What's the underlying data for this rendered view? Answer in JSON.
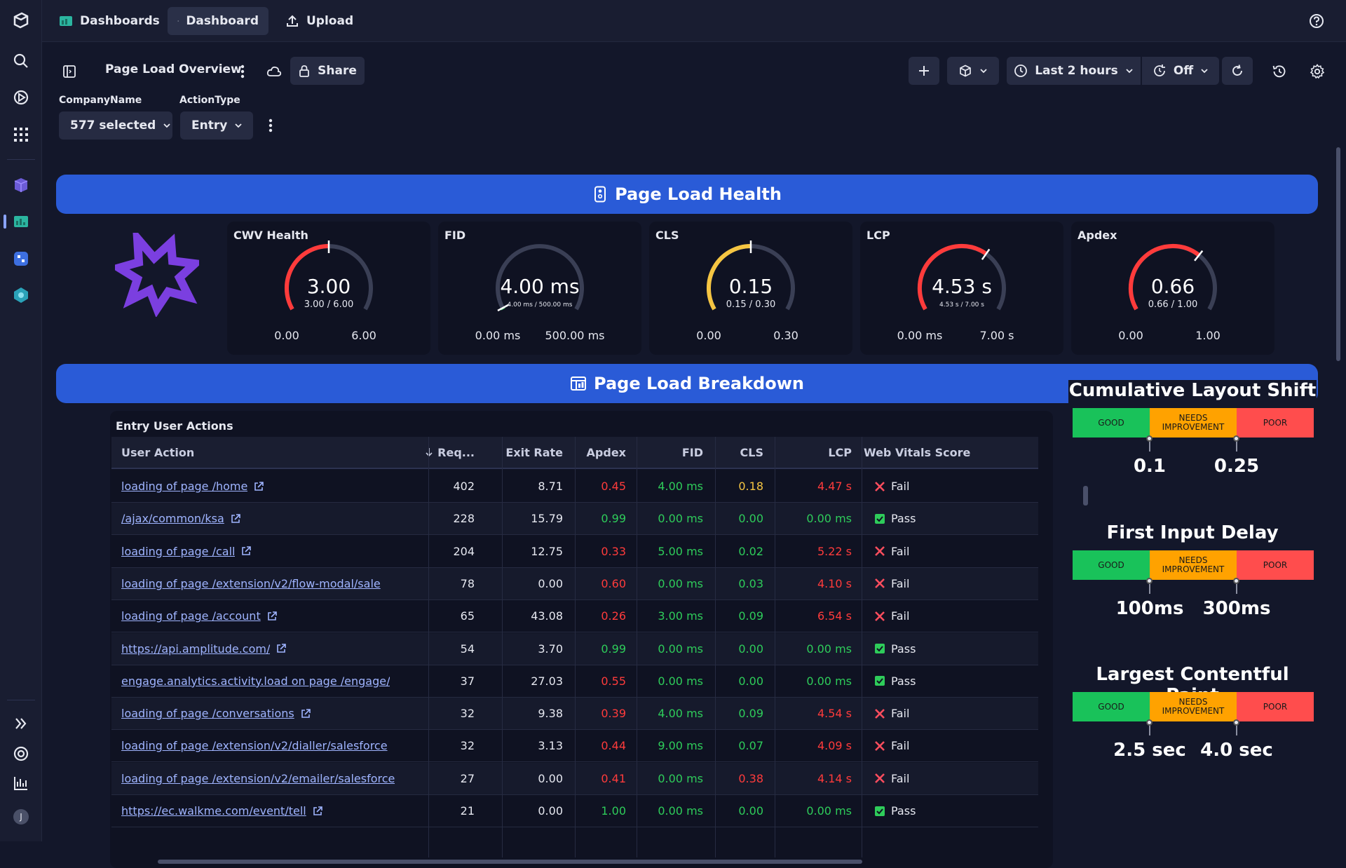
{
  "topbar": {
    "dashboards_label": "Dashboards",
    "new_dashboard_label": "Dashboard",
    "upload_label": "Upload"
  },
  "toolbar": {
    "dashboard_title": "Page Load Overview",
    "share_label": "Share",
    "timeframe_label": "Last 2 hours",
    "refresh_label": "Off"
  },
  "filters": {
    "company": {
      "label": "CompanyName",
      "value": "577 selected"
    },
    "action_type": {
      "label": "ActionType",
      "value": "Entry"
    }
  },
  "sections": {
    "health": "Page Load Health",
    "breakdown": "Page Load Breakdown"
  },
  "gauges": [
    {
      "title": "CWV Health",
      "value": "3.00",
      "sub": "3.00 / 6.00",
      "min": "0.00",
      "max": "6.00",
      "fraction": 0.5,
      "color": "#ff3b3b"
    },
    {
      "title": "FID",
      "value": "4.00 ms",
      "sub": "4.00 ms / 500.00 ms",
      "min": "0.00 ms",
      "max": "500.00 ms",
      "fraction": 0.008,
      "color": "#2ecc5a"
    },
    {
      "title": "CLS",
      "value": "0.15",
      "sub": "0.15 / 0.30",
      "min": "0.00",
      "max": "0.30",
      "fraction": 0.5,
      "color": "#f5c542"
    },
    {
      "title": "LCP",
      "value": "4.53 s",
      "sub": "4.53 s / 7.00 s",
      "min": "0.00 ms",
      "max": "7.00 s",
      "fraction": 0.647,
      "color": "#ff3b3b"
    },
    {
      "title": "Apdex",
      "value": "0.66",
      "sub": "0.66 / 1.00",
      "min": "0.00",
      "max": "1.00",
      "fraction": 0.66,
      "color": "#ff3b3b"
    }
  ],
  "table": {
    "title": "Entry User Actions",
    "columns": [
      "User Action",
      "Req...",
      "Exit Rate",
      "Apdex",
      "FID",
      "CLS",
      "LCP",
      "Web Vitals Score"
    ],
    "rows": [
      {
        "action": "loading of page /home",
        "req": "402",
        "exit": "8.71",
        "apdex": "0.45",
        "apdex_c": "red",
        "fid": "4.00 ms",
        "fid_c": "green",
        "cls": "0.18",
        "cls_c": "yellow",
        "lcp": "4.47 s",
        "lcp_c": "red",
        "score": "Fail",
        "link": true
      },
      {
        "action": "/ajax/common/ksa",
        "req": "228",
        "exit": "15.79",
        "apdex": "0.99",
        "apdex_c": "green",
        "fid": "0.00 ms",
        "fid_c": "green",
        "cls": "0.00",
        "cls_c": "green",
        "lcp": "0.00 ms",
        "lcp_c": "green",
        "score": "Pass",
        "link": true
      },
      {
        "action": "loading of page /call",
        "req": "204",
        "exit": "12.75",
        "apdex": "0.33",
        "apdex_c": "red",
        "fid": "5.00 ms",
        "fid_c": "green",
        "cls": "0.02",
        "cls_c": "green",
        "lcp": "5.22 s",
        "lcp_c": "red",
        "score": "Fail",
        "link": true
      },
      {
        "action": "loading of page /extension/v2/flow-modal/sale",
        "req": "78",
        "exit": "0.00",
        "apdex": "0.60",
        "apdex_c": "red",
        "fid": "0.00 ms",
        "fid_c": "green",
        "cls": "0.03",
        "cls_c": "green",
        "lcp": "4.10 s",
        "lcp_c": "red",
        "score": "Fail",
        "link": false
      },
      {
        "action": "loading of page /account",
        "req": "65",
        "exit": "43.08",
        "apdex": "0.26",
        "apdex_c": "red",
        "fid": "3.00 ms",
        "fid_c": "green",
        "cls": "0.09",
        "cls_c": "green",
        "lcp": "6.54 s",
        "lcp_c": "red",
        "score": "Fail",
        "link": true
      },
      {
        "action": "https://api.amplitude.com/",
        "req": "54",
        "exit": "3.70",
        "apdex": "0.99",
        "apdex_c": "green",
        "fid": "0.00 ms",
        "fid_c": "green",
        "cls": "0.00",
        "cls_c": "green",
        "lcp": "0.00 ms",
        "lcp_c": "green",
        "score": "Pass",
        "link": true
      },
      {
        "action": "engage.analytics.activity.load on page /engage/",
        "req": "37",
        "exit": "27.03",
        "apdex": "0.55",
        "apdex_c": "red",
        "fid": "0.00 ms",
        "fid_c": "green",
        "cls": "0.00",
        "cls_c": "green",
        "lcp": "0.00 ms",
        "lcp_c": "green",
        "score": "Pass",
        "link": false
      },
      {
        "action": "loading of page /conversations",
        "req": "32",
        "exit": "9.38",
        "apdex": "0.39",
        "apdex_c": "red",
        "fid": "4.00 ms",
        "fid_c": "green",
        "cls": "0.09",
        "cls_c": "green",
        "lcp": "4.54 s",
        "lcp_c": "red",
        "score": "Fail",
        "link": true
      },
      {
        "action": "loading of page /extension/v2/dialler/salesforce",
        "req": "32",
        "exit": "3.13",
        "apdex": "0.44",
        "apdex_c": "red",
        "fid": "9.00 ms",
        "fid_c": "green",
        "cls": "0.07",
        "cls_c": "green",
        "lcp": "4.09 s",
        "lcp_c": "red",
        "score": "Fail",
        "link": false
      },
      {
        "action": "loading of page /extension/v2/emailer/salesforce",
        "req": "27",
        "exit": "0.00",
        "apdex": "0.41",
        "apdex_c": "red",
        "fid": "0.00 ms",
        "fid_c": "green",
        "cls": "0.38",
        "cls_c": "red",
        "lcp": "4.14 s",
        "lcp_c": "red",
        "score": "Fail",
        "link": false
      },
      {
        "action": "https://ec.walkme.com/event/tell",
        "req": "21",
        "exit": "0.00",
        "apdex": "1.00",
        "apdex_c": "green",
        "fid": "0.00 ms",
        "fid_c": "green",
        "cls": "0.00",
        "cls_c": "green",
        "lcp": "0.00 ms",
        "lcp_c": "green",
        "score": "Pass",
        "link": true
      }
    ]
  },
  "legends": [
    {
      "title": "Cumulative Layout Shift",
      "good": "GOOD",
      "needs": "NEEDS IMPROVEMENT",
      "poor": "POOR",
      "t1": "0.1",
      "t2": "0.25"
    },
    {
      "title": "First Input Delay",
      "good": "GOOD",
      "needs": "NEEDS IMPROVEMENT",
      "poor": "POOR",
      "t1": "100ms",
      "t2": "300ms"
    },
    {
      "title": "Largest Contentful Paint",
      "good": "GOOD",
      "needs": "NEEDS IMPROVEMENT",
      "poor": "POOR",
      "t1": "2.5 sec",
      "t2": "4.0 sec"
    }
  ],
  "user": {
    "initial": "J"
  },
  "colors": {
    "accent": "#2a5bd7",
    "good": "#19c25a",
    "needs": "#ffa200",
    "poor": "#ff4d4d"
  }
}
